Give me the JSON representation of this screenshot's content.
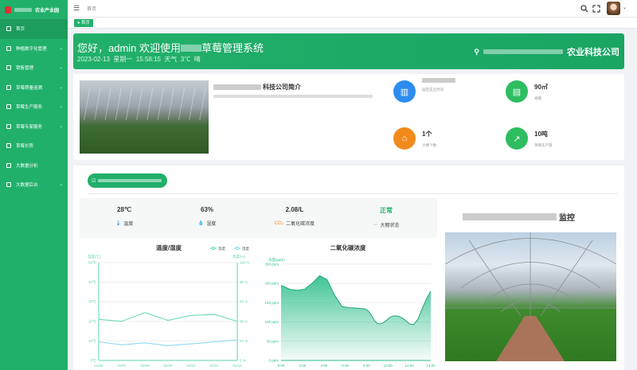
{
  "sidebar": {
    "logo_text": "农业产业园",
    "items": [
      {
        "label": "首页",
        "arrow": ""
      },
      {
        "label": "种植数字化管理",
        "arrow": "⌄"
      },
      {
        "label": "销售管理",
        "arrow": "⌄"
      },
      {
        "label": "草莓质量追溯",
        "arrow": "⌄"
      },
      {
        "label": "草莓生产服务",
        "arrow": "⌄"
      },
      {
        "label": "草莓专家服务",
        "arrow": "⌄"
      },
      {
        "label": "草莓长势",
        "arrow": ""
      },
      {
        "label": "大数据分析",
        "arrow": ""
      },
      {
        "label": "大数据后台",
        "arrow": "⌄"
      }
    ]
  },
  "topbar": {
    "breadcrumb": "首页",
    "menu_icon": "menu-icon",
    "search_icon": "search-icon",
    "fullscreen_icon": "fullscreen-icon",
    "caret": "⌄"
  },
  "tags": {
    "active": "首页"
  },
  "banner": {
    "title_prefix": "您好，admin 欢迎使用",
    "title_suffix": "草莓管理系统",
    "date": "2023-02-13",
    "weekday": "星期一",
    "time": "15:58:15",
    "weather_label": "天气",
    "temp": "3℃",
    "weather": "晴",
    "company_suffix": "农业科技公司"
  },
  "intro": {
    "title_suffix": "科技公司简介",
    "stats": [
      {
        "value": "",
        "label": "园区成立时间",
        "color": "#2d8cf0",
        "icon": "building-icon"
      },
      {
        "value": "90㎡",
        "label": "规模",
        "color": "#2dbe60",
        "icon": "shop-icon"
      },
      {
        "value": "1个",
        "label": "大棚个数",
        "color": "#f28a1b",
        "icon": "greenhouse-icon"
      },
      {
        "value": "10吨",
        "label": "草莓年产量",
        "color": "#2dbe60",
        "icon": "chart-icon"
      }
    ]
  },
  "env": {
    "metrics": [
      {
        "value": "28℃",
        "label": "温度",
        "icon": "🌡"
      },
      {
        "value": "63%",
        "label": "湿度",
        "icon": "💧"
      },
      {
        "value": "2.08/L",
        "label": "二氧化碳浓度",
        "icon": "CO₂"
      },
      {
        "value": "正常",
        "label": "大棚状态",
        "icon": "⋯"
      }
    ]
  },
  "monitor": {
    "title_suffix": "监控"
  },
  "chart_data": [
    {
      "type": "line",
      "title": "温度/湿度",
      "legend": [
        "温度",
        "湿度"
      ],
      "ylabel_left": "温度(℃)",
      "ylabel_right": "湿度(%)",
      "ylim_left": [
        0,
        50
      ],
      "ylim_right": [
        0,
        100
      ],
      "yticks_left": [
        "0℃",
        "10℃",
        "20℃",
        "30℃",
        "40℃",
        "50℃"
      ],
      "yticks_right": [
        "0 %",
        "20 %",
        "40 %",
        "60 %",
        "80 %",
        "100 %"
      ],
      "categories": [
        "02/06",
        "02/07",
        "02/08",
        "02/09",
        "02/10",
        "02/11",
        "02/12"
      ],
      "series": [
        {
          "name": "温度",
          "axis": "left",
          "color": "#5fd6a8",
          "values": [
            21,
            20,
            24.5,
            20.5,
            23,
            23.5,
            20
          ]
        },
        {
          "name": "湿度",
          "axis": "right",
          "color": "#7fd8f0",
          "values": [
            19,
            16,
            18,
            15,
            17,
            19,
            21
          ]
        }
      ]
    },
    {
      "type": "area",
      "title": "二氧化碳浓度",
      "ylabel": "浓度(ppm)",
      "ylim": [
        0,
        250
      ],
      "yticks": [
        "0 ppm",
        "50 ppm",
        "100 ppm",
        "150 ppm",
        "200 ppm",
        "250 ppm"
      ],
      "categories": [
        "0:00",
        "2:00",
        "4:00",
        "6:00",
        "8:00",
        "10:00",
        "12:00",
        "14:00"
      ],
      "color": "#2dbe8a",
      "x": [
        0,
        0.8,
        1.5,
        2.2,
        2.9,
        3.6,
        4.3,
        5.0,
        5.7,
        6.4,
        7.0,
        7.4,
        7.8,
        8.1,
        8.4,
        8.7,
        9.0,
        9.3,
        9.6,
        9.9,
        10.2,
        10.5,
        11.0,
        11.5,
        12.0,
        12.4,
        12.8,
        13.2,
        13.6,
        14.0
      ],
      "values": [
        195,
        185,
        182,
        185,
        200,
        220,
        210,
        170,
        140,
        137,
        136,
        135,
        134,
        130,
        120,
        105,
        96,
        95,
        99,
        105,
        112,
        116,
        115,
        107,
        95,
        93,
        107,
        135,
        160,
        180
      ]
    }
  ]
}
